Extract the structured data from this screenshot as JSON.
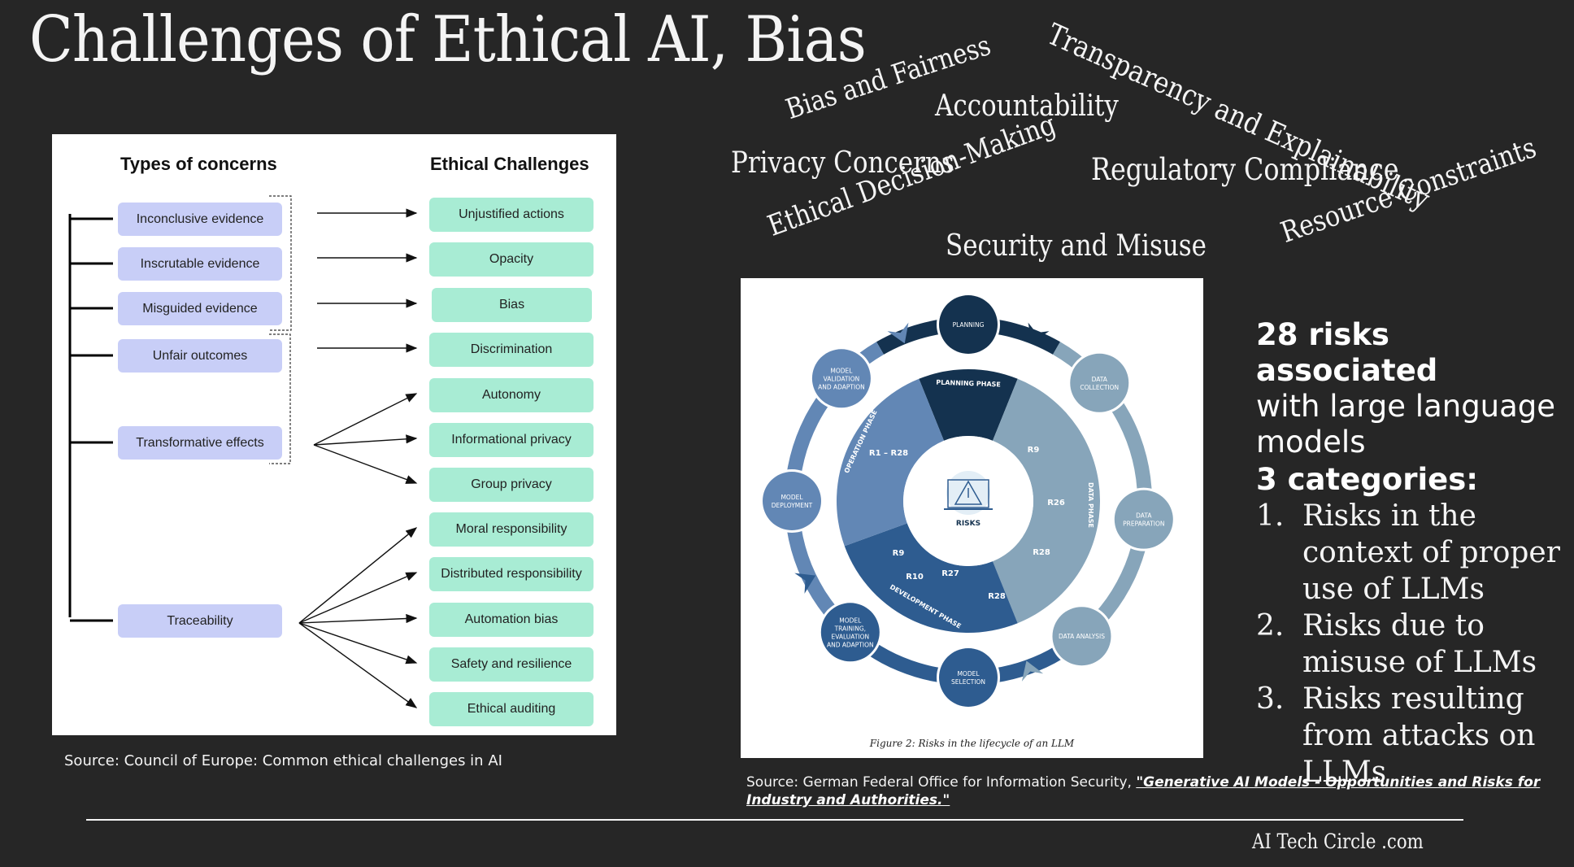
{
  "slide": {
    "title": "Challenges of Ethical AI, Bias",
    "word_cloud": [
      "Transparency and Explainability",
      "Bias and Fairness",
      "Accountability",
      "Privacy Concerns",
      "Ethical Decision-Making",
      "Regulatory Compliance",
      "Security and Misuse",
      "Resource Constraints"
    ]
  },
  "left_diagram": {
    "concerns_heading": "Types of concerns",
    "challenges_heading": "Ethical Challenges",
    "concerns": [
      "Inconclusive evidence",
      "Inscrutable evidence",
      "Misguided evidence",
      "Unfair outcomes",
      "Transformative effects",
      "Traceability"
    ],
    "challenges": [
      "Unjustified actions",
      "Opacity",
      "Bias",
      "Discrimination",
      "Autonomy",
      "Informational privacy",
      "Group privacy",
      "Moral responsibility",
      "Distributed responsibility",
      "Automation bias",
      "Safety and resilience",
      "Ethical auditing"
    ],
    "links": [
      {
        "from": "Inconclusive evidence",
        "to": [
          "Unjustified actions"
        ]
      },
      {
        "from": "Inscrutable evidence",
        "to": [
          "Opacity"
        ]
      },
      {
        "from": "Misguided evidence",
        "to": [
          "Bias"
        ]
      },
      {
        "from": "Unfair outcomes",
        "to": [
          "Discrimination"
        ]
      },
      {
        "from": "Transformative effects",
        "to": [
          "Autonomy",
          "Informational privacy",
          "Group privacy"
        ]
      },
      {
        "from": "Traceability",
        "to": [
          "Moral responsibility",
          "Distributed responsibility",
          "Automation bias",
          "Safety and resilience",
          "Ethical auditing"
        ]
      }
    ],
    "source": "Source: Council of Europe: Common ethical challenges in AI"
  },
  "lifecycle_figure": {
    "stages": [
      "PLANNING",
      "DATA COLLECTION",
      "DATA PREPARATION",
      "DATA ANALYSIS",
      "MODEL SELECTION",
      "MODEL TRAINING, EVALUATION AND ADAPTION",
      "MODEL DEPLOYMENT",
      "MODEL VALIDATION AND ADAPTION"
    ],
    "phases": [
      {
        "name": "PLANNING PHASE",
        "risks": []
      },
      {
        "name": "DATA PHASE",
        "risks": [
          "R9",
          "R26",
          "R28"
        ]
      },
      {
        "name": "DEVELOPMENT PHASE",
        "risks": [
          "R9",
          "R10",
          "R27",
          "R28"
        ]
      },
      {
        "name": "OPERATION PHASE",
        "risks": [
          "R1 – R28"
        ]
      }
    ],
    "center_label": "RISKS",
    "caption": "Figure 2: Risks in the lifecycle of an LLM",
    "colors": {
      "planning": "#14324f",
      "data": "#87a5ba",
      "development": "#2e5c90",
      "operation": "#6287b5"
    }
  },
  "risks_summary": {
    "headline_bold": "28 risks associated",
    "headline_rest": "with large language models",
    "categories_heading": "3 categories:",
    "categories": [
      {
        "num": "1.",
        "text": "Risks in the context of proper use of LLMs"
      },
      {
        "num": "2.",
        "text": "Risks due to misuse of LLMs"
      },
      {
        "num": "3.",
        "text": "Risks resulting from attacks on LLMs"
      }
    ]
  },
  "right_source": {
    "prefix": "Source: German Federal Office for Information Security, ",
    "link_text": "\"Generative AI Models - Opportunities and Risks for Industry and Authorities.\""
  },
  "footer": {
    "brand": "AI Tech Circle .com"
  }
}
